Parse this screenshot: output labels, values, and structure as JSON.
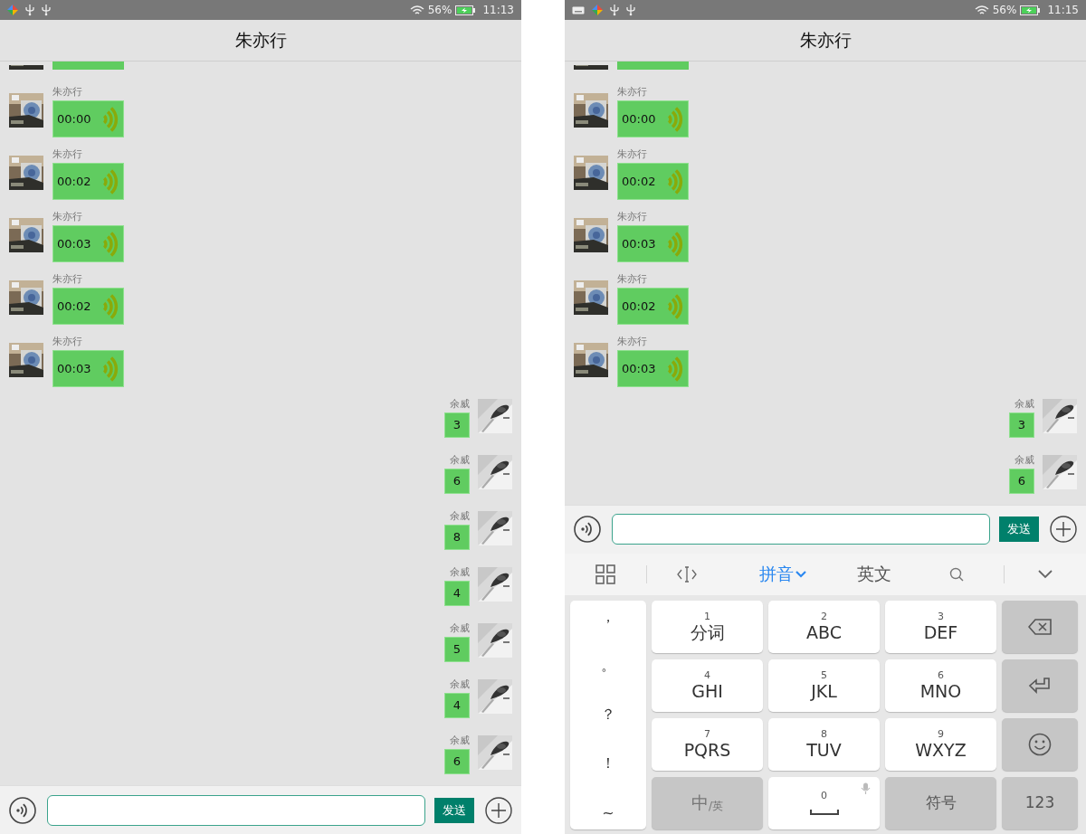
{
  "phones": [
    {
      "status_bar": {
        "keyboard_indicator": false,
        "battery_percent": "56%",
        "time": "11:13"
      },
      "title": "朱亦行",
      "messages": [
        {
          "kind": "clipped",
          "outgoing": false
        },
        {
          "kind": "voice",
          "outgoing": false,
          "sender": "朱亦行",
          "duration": "00:00"
        },
        {
          "kind": "voice",
          "outgoing": false,
          "sender": "朱亦行",
          "duration": "00:02"
        },
        {
          "kind": "voice",
          "outgoing": false,
          "sender": "朱亦行",
          "duration": "00:03"
        },
        {
          "kind": "voice",
          "outgoing": false,
          "sender": "朱亦行",
          "duration": "00:02"
        },
        {
          "kind": "voice",
          "outgoing": false,
          "sender": "朱亦行",
          "duration": "00:03"
        },
        {
          "kind": "text",
          "outgoing": true,
          "sender": "余威",
          "text": "3"
        },
        {
          "kind": "text",
          "outgoing": true,
          "sender": "余威",
          "text": "6"
        },
        {
          "kind": "text",
          "outgoing": true,
          "sender": "余威",
          "text": "8"
        },
        {
          "kind": "text",
          "outgoing": true,
          "sender": "余威",
          "text": "4"
        },
        {
          "kind": "text",
          "outgoing": true,
          "sender": "余威",
          "text": "5"
        },
        {
          "kind": "text",
          "outgoing": true,
          "sender": "余威",
          "text": "4"
        },
        {
          "kind": "text",
          "outgoing": true,
          "sender": "余威",
          "text": "6"
        }
      ],
      "input_bar": {
        "send_label": "发送"
      }
    },
    {
      "status_bar": {
        "keyboard_indicator": true,
        "battery_percent": "56%",
        "time": "11:15"
      },
      "title": "朱亦行",
      "messages": [
        {
          "kind": "clipped",
          "outgoing": false
        },
        {
          "kind": "voice",
          "outgoing": false,
          "sender": "朱亦行",
          "duration": "00:00"
        },
        {
          "kind": "voice",
          "outgoing": false,
          "sender": "朱亦行",
          "duration": "00:02"
        },
        {
          "kind": "voice",
          "outgoing": false,
          "sender": "朱亦行",
          "duration": "00:03"
        },
        {
          "kind": "voice",
          "outgoing": false,
          "sender": "朱亦行",
          "duration": "00:02"
        },
        {
          "kind": "voice",
          "outgoing": false,
          "sender": "朱亦行",
          "duration": "00:03"
        },
        {
          "kind": "text",
          "outgoing": true,
          "sender": "余威",
          "text": "3"
        },
        {
          "kind": "text",
          "outgoing": true,
          "sender": "余威",
          "text": "6"
        }
      ],
      "input_bar": {
        "send_label": "发送"
      },
      "keyboard": {
        "tabs": [
          {
            "label": "拼音",
            "selected": true
          },
          {
            "label": "英文",
            "selected": false
          }
        ],
        "punctuation": [
          "，",
          "。",
          "？",
          "！",
          "~"
        ],
        "keys": [
          {
            "kind": "letters",
            "digit": "1",
            "label": "分词"
          },
          {
            "kind": "letters",
            "digit": "2",
            "label": "ABC"
          },
          {
            "kind": "letters",
            "digit": "3",
            "label": "DEF"
          },
          {
            "kind": "backspace"
          },
          {
            "kind": "letters",
            "digit": "4",
            "label": "GHI"
          },
          {
            "kind": "letters",
            "digit": "5",
            "label": "JKL"
          },
          {
            "kind": "letters",
            "digit": "6",
            "label": "MNO"
          },
          {
            "kind": "enter"
          },
          {
            "kind": "letters",
            "digit": "7",
            "label": "PQRS"
          },
          {
            "kind": "letters",
            "digit": "8",
            "label": "TUV"
          },
          {
            "kind": "letters",
            "digit": "9",
            "label": "WXYZ"
          },
          {
            "kind": "emoji"
          },
          {
            "kind": "language",
            "label": "中",
            "sub_label": "/英"
          },
          {
            "kind": "space",
            "digit": "0"
          },
          {
            "kind": "function",
            "label": "符号"
          },
          {
            "kind": "function",
            "label": "123"
          }
        ]
      }
    }
  ]
}
